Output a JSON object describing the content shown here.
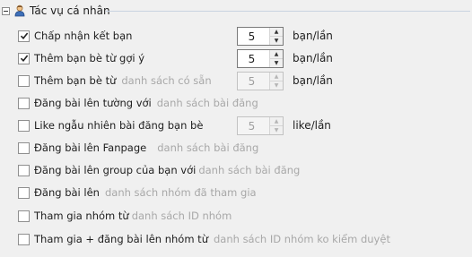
{
  "group": {
    "title": "Tác vụ cá nhân"
  },
  "rows": [
    {
      "label": "Chấp nhận kết bạn",
      "checked": true,
      "spin": "5",
      "unit": "bạn/lần"
    },
    {
      "label": "Thêm bạn bè từ gợi ý",
      "checked": true,
      "spin": "5",
      "unit": "bạn/lần"
    },
    {
      "label": "Thêm bạn bè từ",
      "link": "danh sách có sẵn",
      "checked": false,
      "spin": "5",
      "unit": "bạn/lần"
    },
    {
      "label": "Đăng bài lên tường với",
      "link": "danh sách bài đăng",
      "checked": false
    },
    {
      "label": "Like ngẫu nhiên bài đăng bạn bè",
      "checked": false,
      "spin": "5",
      "unit": "like/lần"
    },
    {
      "label": "Đăng bài lên Fanpage",
      "link": "danh sách bài đăng",
      "checked": false
    },
    {
      "label": "Đăng bài lên group của bạn với",
      "link": "danh sách bài đăng",
      "checked": false
    },
    {
      "label": "Đăng bài lên",
      "link": "danh sách nhóm đã tham gia",
      "checked": false
    },
    {
      "label": "Tham gia nhóm từ",
      "link": "danh sách ID nhóm",
      "checked": false
    },
    {
      "label": "Tham gia + đăng bài lên nhóm từ",
      "link": "danh sách ID nhóm ko kiểm duyệt",
      "checked": false
    }
  ]
}
